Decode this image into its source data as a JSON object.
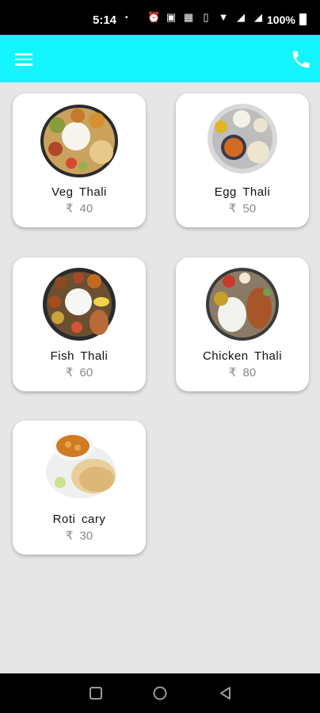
{
  "status_bar": {
    "time": "5:14",
    "dot": "•",
    "battery": "100%"
  },
  "app_bar": {
    "menu_icon": "menu-icon",
    "phone_icon": "phone-icon",
    "color": "#14f4ff"
  },
  "menu_items": [
    {
      "name": "Veg Thali",
      "price": "₹ 40"
    },
    {
      "name": "Egg Thali",
      "price": "₹ 50"
    },
    {
      "name": "Fish Thali",
      "price": "₹ 60"
    },
    {
      "name": "Chicken Thali",
      "price": "₹ 80"
    },
    {
      "name": "Roti cary",
      "price": "₹ 30"
    }
  ],
  "nav_bar": {
    "icons": [
      "recents-icon",
      "home-icon",
      "back-icon"
    ]
  }
}
